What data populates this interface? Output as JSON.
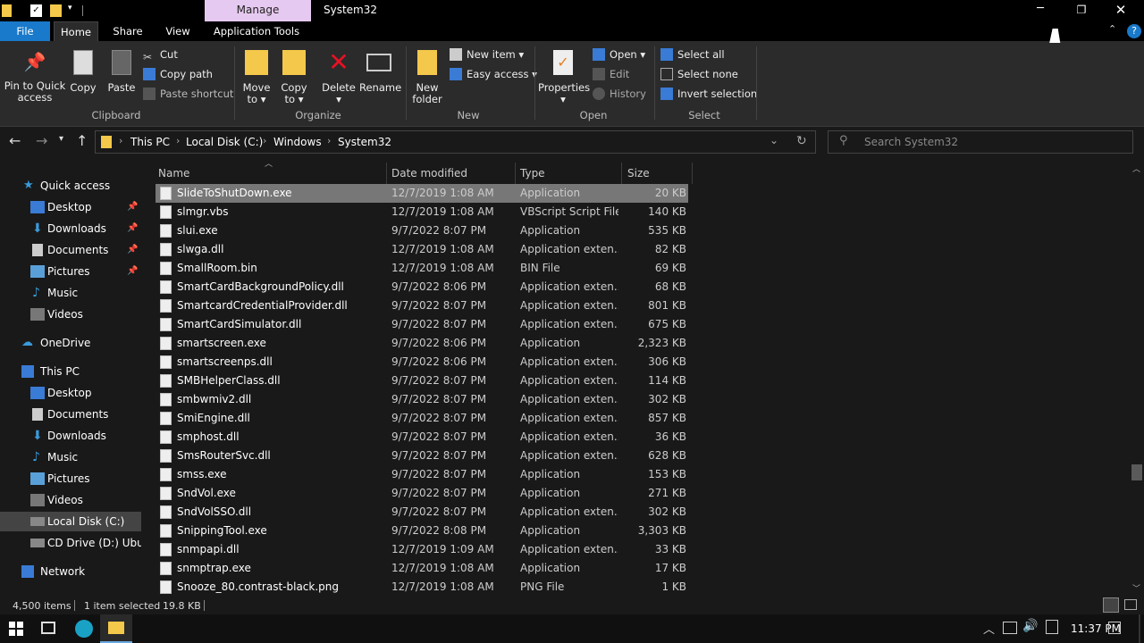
{
  "window": {
    "manage_tab": "Manage",
    "title": "System32",
    "quick_access_icons": [
      "folder-icon",
      "checkmark-icon",
      "new-folder-icon",
      "dropdown-arrow-icon"
    ],
    "controls": {
      "minimize": "minimize-icon",
      "maximize": "restore-icon",
      "close": "close-icon"
    }
  },
  "ribbon_tabs": [
    "File",
    "Home",
    "Share",
    "View",
    "Application Tools"
  ],
  "ribbon": {
    "clipboard": {
      "group_label": "Clipboard",
      "pin_label_1": "Pin to Quick",
      "pin_label_2": "access",
      "copy_label": "Copy",
      "paste_label": "Paste",
      "cut_label": "Cut",
      "copy_path_label": "Copy path",
      "paste_shortcut_label": "Paste shortcut"
    },
    "organize": {
      "group_label": "Organize",
      "move_to_1": "Move",
      "move_to_2": "to",
      "copy_to_1": "Copy",
      "copy_to_2": "to",
      "delete_label": "Delete",
      "rename_label": "Rename"
    },
    "new": {
      "group_label": "New",
      "new_folder_1": "New",
      "new_folder_2": "folder",
      "new_item_label": "New item",
      "easy_access_label": "Easy access"
    },
    "open": {
      "group_label": "Open",
      "properties_label": "Properties",
      "open_label": "Open",
      "edit_label": "Edit",
      "history_label": "History"
    },
    "select": {
      "group_label": "Select",
      "select_all_label": "Select all",
      "select_none_label": "Select none",
      "invert_selection_label": "Invert selection"
    }
  },
  "address": {
    "crumbs": [
      "This PC",
      "Local Disk (C:)",
      "Windows",
      "System32"
    ],
    "search_placeholder": "Search System32"
  },
  "sidebar": {
    "quick_access": "Quick access",
    "quick_items": [
      "Desktop",
      "Downloads",
      "Documents",
      "Pictures",
      "Music",
      "Videos"
    ],
    "onedrive": "OneDrive",
    "this_pc": "This PC",
    "pc_items": [
      "Desktop",
      "Documents",
      "Downloads",
      "Music",
      "Pictures",
      "Videos",
      "Local Disk (C:)",
      "CD Drive (D:) Ubunt"
    ],
    "network": "Network"
  },
  "columns": {
    "name": "Name",
    "date": "Date modified",
    "type": "Type",
    "size": "Size"
  },
  "files": [
    {
      "name": "SlideToShutDown.exe",
      "date": "12/7/2019 1:08 AM",
      "type": "Application",
      "size": "20 KB"
    },
    {
      "name": "slmgr.vbs",
      "date": "12/7/2019 1:08 AM",
      "type": "VBScript Script File",
      "size": "140 KB"
    },
    {
      "name": "slui.exe",
      "date": "9/7/2022 8:07 PM",
      "type": "Application",
      "size": "535 KB"
    },
    {
      "name": "slwga.dll",
      "date": "12/7/2019 1:08 AM",
      "type": "Application exten...",
      "size": "82 KB"
    },
    {
      "name": "SmallRoom.bin",
      "date": "12/7/2019 1:08 AM",
      "type": "BIN File",
      "size": "69 KB"
    },
    {
      "name": "SmartCardBackgroundPolicy.dll",
      "date": "9/7/2022 8:06 PM",
      "type": "Application exten...",
      "size": "68 KB"
    },
    {
      "name": "SmartcardCredentialProvider.dll",
      "date": "9/7/2022 8:07 PM",
      "type": "Application exten...",
      "size": "801 KB"
    },
    {
      "name": "SmartCardSimulator.dll",
      "date": "9/7/2022 8:07 PM",
      "type": "Application exten...",
      "size": "675 KB"
    },
    {
      "name": "smartscreen.exe",
      "date": "9/7/2022 8:06 PM",
      "type": "Application",
      "size": "2,323 KB"
    },
    {
      "name": "smartscreenps.dll",
      "date": "9/7/2022 8:06 PM",
      "type": "Application exten...",
      "size": "306 KB"
    },
    {
      "name": "SMBHelperClass.dll",
      "date": "9/7/2022 8:07 PM",
      "type": "Application exten...",
      "size": "114 KB"
    },
    {
      "name": "smbwmiv2.dll",
      "date": "9/7/2022 8:07 PM",
      "type": "Application exten...",
      "size": "302 KB"
    },
    {
      "name": "SmiEngine.dll",
      "date": "9/7/2022 8:07 PM",
      "type": "Application exten...",
      "size": "857 KB"
    },
    {
      "name": "smphost.dll",
      "date": "9/7/2022 8:07 PM",
      "type": "Application exten...",
      "size": "36 KB"
    },
    {
      "name": "SmsRouterSvc.dll",
      "date": "9/7/2022 8:07 PM",
      "type": "Application exten...",
      "size": "628 KB"
    },
    {
      "name": "smss.exe",
      "date": "9/7/2022 8:07 PM",
      "type": "Application",
      "size": "153 KB"
    },
    {
      "name": "SndVol.exe",
      "date": "9/7/2022 8:07 PM",
      "type": "Application",
      "size": "271 KB"
    },
    {
      "name": "SndVolSSO.dll",
      "date": "9/7/2022 8:07 PM",
      "type": "Application exten...",
      "size": "302 KB"
    },
    {
      "name": "SnippingTool.exe",
      "date": "9/7/2022 8:08 PM",
      "type": "Application",
      "size": "3,303 KB"
    },
    {
      "name": "snmpapi.dll",
      "date": "12/7/2019 1:09 AM",
      "type": "Application exten...",
      "size": "33 KB"
    },
    {
      "name": "snmptrap.exe",
      "date": "12/7/2019 1:08 AM",
      "type": "Application",
      "size": "17 KB"
    },
    {
      "name": "Snooze_80.contrast-black.png",
      "date": "12/7/2019 1:08 AM",
      "type": "PNG File",
      "size": "1 KB"
    }
  ],
  "status": {
    "items": "4,500 items",
    "selected": "1 item selected",
    "size": "19.8 KB"
  },
  "taskbar": {
    "clock": "11:37 PM"
  },
  "colors": {
    "accent": "#1e90ff",
    "folder": "#f4c84a",
    "delete_red": "#e81123"
  }
}
